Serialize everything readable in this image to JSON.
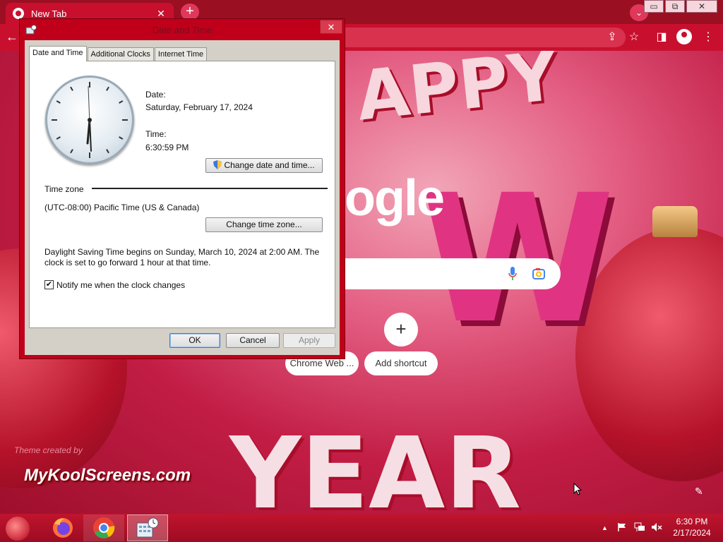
{
  "browser": {
    "tab_title": "New Tab",
    "tab_close": "✕",
    "new_tab": "+",
    "tab_search": "⌄",
    "window_min": "▭",
    "window_max": "⧉",
    "window_close": "✕",
    "back": "←",
    "share": "⇪",
    "bookmark": "☆",
    "sidepanel": "◨",
    "menu": "⋮"
  },
  "ntp": {
    "logo_fragment": "ogle",
    "add_shortcut_plus": "+",
    "shortcuts": [
      "Chrome Web ...",
      "Add shortcut"
    ],
    "theme_credit": "Theme created by",
    "theme_brand": "MyKoolScreens.com",
    "customize": "✎",
    "deco_happy": "APPY",
    "deco_new": "W",
    "deco_year": "YEAR"
  },
  "dialog": {
    "title": "Date and Time",
    "close": "✕",
    "tabs": [
      "Date and Time",
      "Additional Clocks",
      "Internet Time"
    ],
    "date_label": "Date:",
    "date_value": "Saturday, February 17, 2024",
    "time_label": "Time:",
    "time_value": "6:30:59 PM",
    "change_datetime_button": "Change date and time...",
    "timezone_heading": "Time zone",
    "timezone_value": "(UTC-08:00) Pacific Time (US & Canada)",
    "change_timezone_button": "Change time zone...",
    "dst_line1": "Daylight Saving Time begins on Sunday, March 10, 2024 at 2:00 AM. The",
    "dst_line2": "clock is set to go forward 1 hour at that time.",
    "notify_checked": "✔",
    "notify_label": "Notify me when the clock changes",
    "ok": "OK",
    "cancel": "Cancel",
    "apply": "Apply"
  },
  "taskbar": {
    "apps": [
      "firefox-icon",
      "chrome-icon",
      "date-time-icon"
    ],
    "tray_arrow": "▲",
    "time": "6:30 PM",
    "date": "2/17/2024"
  },
  "colors": {
    "theme_red": "#c8102e",
    "dialog_frame": "#c0001a",
    "dialog_body": "#d4d0c8"
  }
}
